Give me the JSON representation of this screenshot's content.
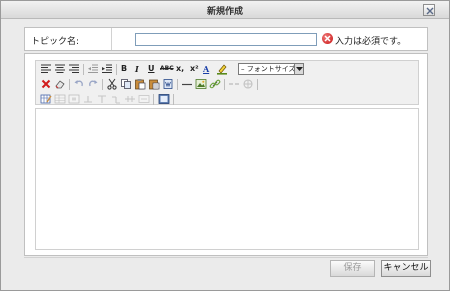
{
  "dialog": {
    "title": "新規作成"
  },
  "topic": {
    "label": "トピック名:",
    "value": "",
    "required_text": "入力は必須です。"
  },
  "toolbar": {
    "bold": "B",
    "italic": "I",
    "underline": "U",
    "strike": "ABC",
    "subscript": "x,",
    "superscript": "x²",
    "font_color": "A",
    "font_size_selected": "– フォントサイズ –"
  },
  "footer": {
    "save_label": "保存",
    "cancel_label": "キャンセル"
  },
  "colors": {
    "required_icon": "#c81414",
    "input_border": "#7f9db9",
    "disabled_text": "#9a9a9a"
  }
}
